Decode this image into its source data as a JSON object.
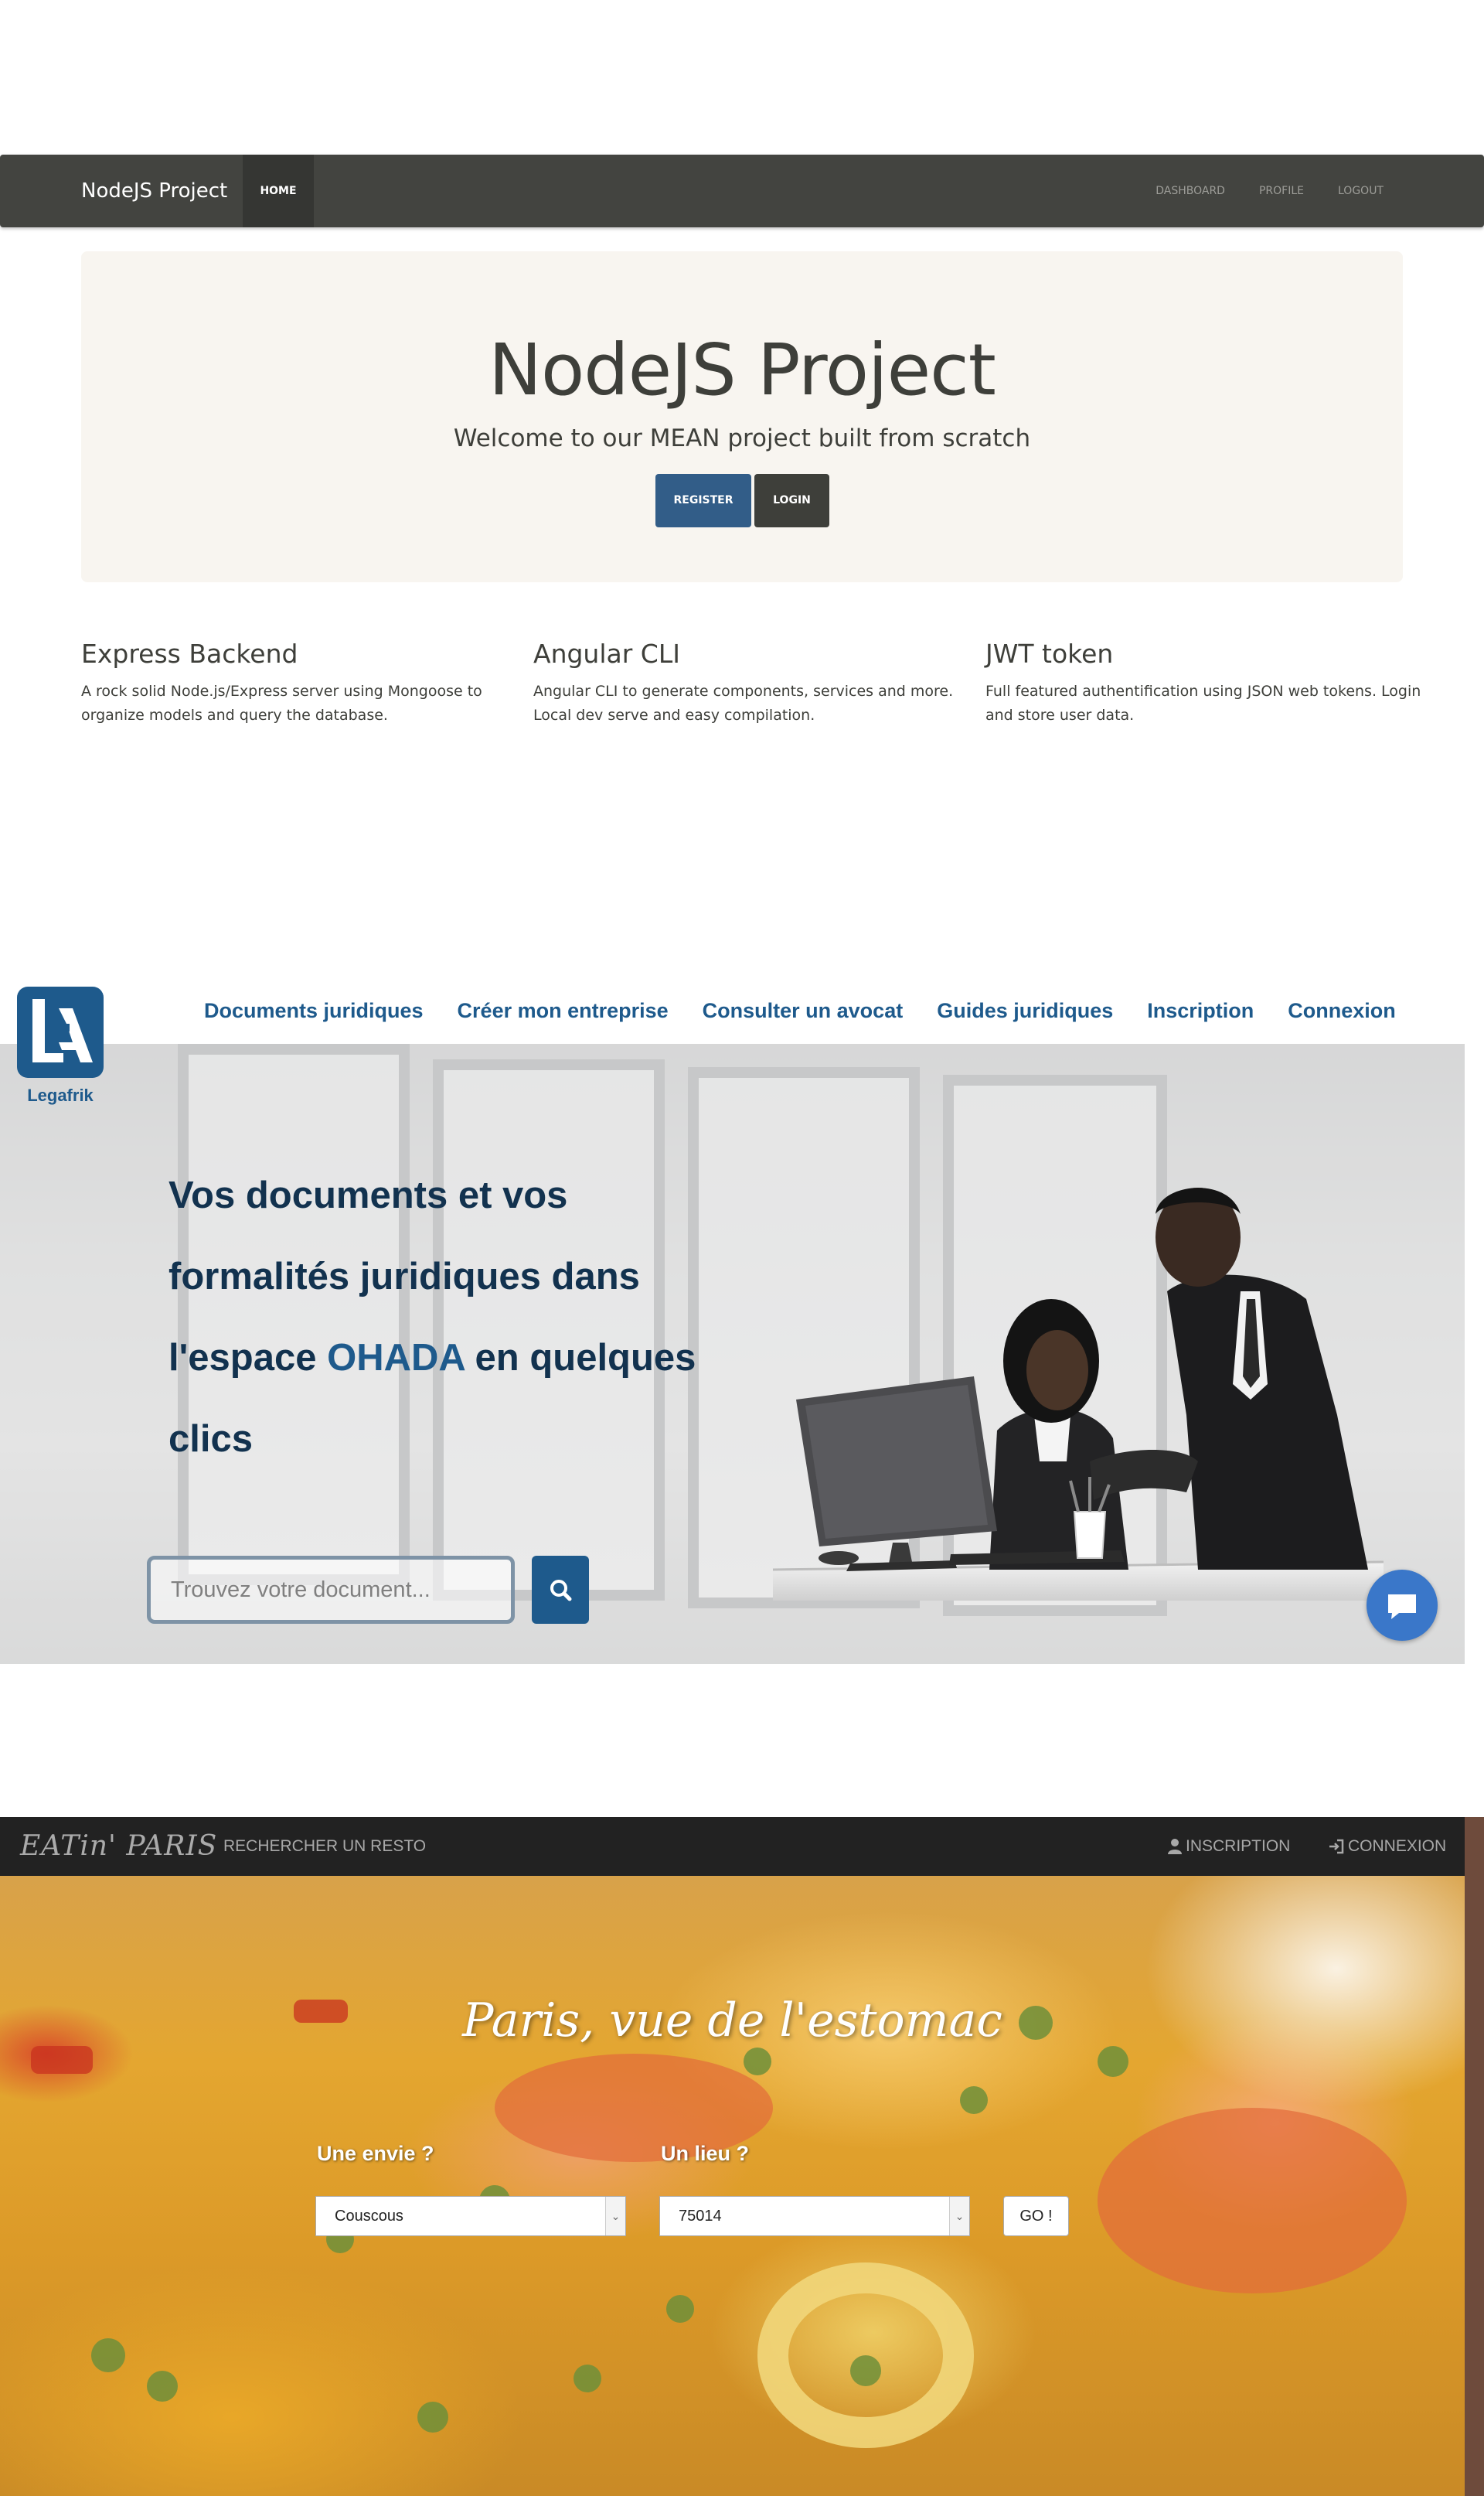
{
  "nodejs": {
    "nav": {
      "brand": "NodeJS Project",
      "home": "HOME",
      "dashboard": "DASHBOARD",
      "profile": "PROFILE",
      "logout": "LOGOUT"
    },
    "jumbotron": {
      "title": "NodeJS Project",
      "subtitle": "Welcome to our MEAN project built from scratch",
      "register": "REGISTER",
      "login": "LOGIN"
    },
    "features": [
      {
        "title": "Express Backend",
        "text": "A rock solid Node.js/Express server using Mongoose to organize models and query the database."
      },
      {
        "title": "Angular CLI",
        "text": "Angular CLI to generate components, services and more. Local dev serve and easy compilation."
      },
      {
        "title": "JWT token",
        "text": "Full featured authentification using JSON web tokens. Login and store user data."
      }
    ],
    "colors": {
      "navbar": "#434440",
      "primary": "#325d88",
      "dark": "#3e3f3a",
      "jumbotron": "#f8f5f0"
    }
  },
  "legafrik": {
    "logo_text": "Legafrik",
    "nav": [
      "Documents juridiques",
      "Créer mon entreprise",
      "Consulter un avocat",
      "Guides juridiques",
      "Inscription",
      "Connexion"
    ],
    "headline": {
      "line1": "Vos documents et vos",
      "line2": "formalités juridiques dans",
      "line3_pre": "l'espace ",
      "line3_highlight": "OHADA",
      "line3_post": " en quelques",
      "line4": "clics"
    },
    "search": {
      "placeholder": "Trouvez votre document..."
    },
    "icons": {
      "search": "search-icon",
      "chat": "chat-icon"
    },
    "colors": {
      "brand": "#1e5a8c",
      "headline": "#12324f"
    }
  },
  "eatin": {
    "nav": {
      "brand": "EATin' PARIS",
      "search_link": "RECHERCHER UN RESTO",
      "register": "INSCRIPTION",
      "login": "CONNEXION"
    },
    "tagline": "Paris, vue de l'estomac",
    "form": {
      "craving_label": "Une envie ?",
      "craving_value": "Couscous",
      "place_label": "Un lieu ?",
      "place_value": "75014",
      "go": "GO !"
    },
    "icons": {
      "register": "user-icon",
      "login": "sign-in-icon"
    },
    "colors": {
      "navbar": "#222222"
    }
  }
}
